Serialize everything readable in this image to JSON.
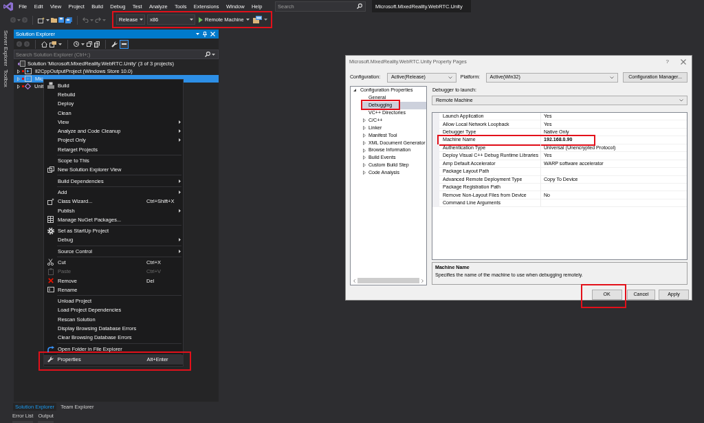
{
  "menu_bar": {
    "items": [
      "File",
      "Edit",
      "View",
      "Project",
      "Build",
      "Debug",
      "Test",
      "Analyze",
      "Tools",
      "Extensions",
      "Window",
      "Help"
    ],
    "search": {
      "placeholder": "Search"
    },
    "solution_title": "Microsoft.MixedReality.WebRTC.Unity"
  },
  "toolbar": {
    "run_group": {
      "outlined": true,
      "configuration": "Release",
      "platform": "x86",
      "start_button": "Remote Machine"
    }
  },
  "side_tabs": [
    "Server Explorer",
    "Toolbox"
  ],
  "solution_explorer": {
    "title": "Solution Explorer",
    "toolbar_toggle": {
      "on": true
    },
    "search": {
      "placeholder": "Search Solution Explorer (Ctrl+;)"
    },
    "tree": [
      {
        "label": "Solution 'Microsoft.MixedReality.WebRTC.Unity' (3 of 3 projects)",
        "selected": false,
        "children": [
          {
            "label": "Il2CppOutputProject (Windows Store 10.0)",
            "kind": "project",
            "expanded": false,
            "selected": false
          },
          {
            "label": "Mic",
            "kind": "project",
            "expanded": false,
            "selected": true
          },
          {
            "label": "Unit",
            "kind": "shared",
            "expanded": false,
            "selected": false
          }
        ]
      }
    ],
    "tabs": [
      {
        "label": "Solution Explorer",
        "selected": true
      },
      {
        "label": "Team Explorer",
        "selected": false
      }
    ]
  },
  "tool_tabs": [
    "Error List",
    "Output"
  ],
  "context_menu": {
    "sections": [
      [
        {
          "label": "Build",
          "submenu": false,
          "disabled": false,
          "hovered": false,
          "outlined": false
        },
        {
          "label": "Rebuild",
          "submenu": false,
          "disabled": false,
          "hovered": false,
          "outlined": false
        },
        {
          "label": "Deploy",
          "submenu": false,
          "disabled": false,
          "hovered": false,
          "outlined": false
        },
        {
          "label": "Clean",
          "submenu": false,
          "disabled": false,
          "hovered": false,
          "outlined": false
        },
        {
          "label": "View",
          "submenu": true,
          "disabled": false,
          "hovered": false,
          "outlined": false
        },
        {
          "label": "Analyze and Code Cleanup",
          "submenu": true,
          "disabled": false,
          "hovered": false,
          "outlined": false
        },
        {
          "label": "Project Only",
          "submenu": true,
          "disabled": false,
          "hovered": false,
          "outlined": false
        },
        {
          "label": "Retarget Projects",
          "submenu": false,
          "disabled": false,
          "hovered": false,
          "outlined": false
        }
      ],
      [
        {
          "label": "Scope to This",
          "submenu": false,
          "disabled": false,
          "hovered": false,
          "outlined": false
        },
        {
          "label": "New Solution Explorer View",
          "submenu": false,
          "disabled": false,
          "hovered": false,
          "outlined": false
        }
      ],
      [
        {
          "label": "Build Dependencies",
          "submenu": true,
          "disabled": false,
          "hovered": false,
          "outlined": false
        }
      ],
      [
        {
          "label": "Add",
          "submenu": true,
          "disabled": false,
          "hovered": false,
          "outlined": false
        },
        {
          "label": "Class Wizard...",
          "shortcut": "Ctrl+Shift+X",
          "submenu": false,
          "disabled": false,
          "hovered": false,
          "outlined": false
        },
        {
          "label": "Publish",
          "submenu": true,
          "disabled": false,
          "hovered": false,
          "outlined": false
        },
        {
          "label": "Manage NuGet Packages...",
          "submenu": false,
          "disabled": false,
          "hovered": false,
          "outlined": false
        }
      ],
      [
        {
          "label": "Set as StartUp Project",
          "submenu": false,
          "disabled": false,
          "hovered": false,
          "outlined": false
        },
        {
          "label": "Debug",
          "submenu": true,
          "disabled": false,
          "hovered": false,
          "outlined": false
        }
      ],
      [
        {
          "label": "Source Control",
          "submenu": true,
          "disabled": false,
          "hovered": false,
          "outlined": false
        }
      ],
      [
        {
          "label": "Cut",
          "shortcut": "Ctrl+X",
          "submenu": false,
          "disabled": false,
          "hovered": false,
          "outlined": false
        },
        {
          "label": "Paste",
          "shortcut": "Ctrl+V",
          "submenu": false,
          "disabled": true,
          "hovered": false,
          "outlined": false
        },
        {
          "label": "Remove",
          "shortcut": "Del",
          "submenu": false,
          "disabled": false,
          "hovered": false,
          "outlined": false
        },
        {
          "label": "Rename",
          "submenu": false,
          "disabled": false,
          "hovered": false,
          "outlined": false
        }
      ],
      [
        {
          "label": "Unload Project",
          "submenu": false,
          "disabled": false,
          "hovered": false,
          "outlined": false
        },
        {
          "label": "Load Project Dependencies",
          "submenu": false,
          "disabled": false,
          "hovered": false,
          "outlined": false
        },
        {
          "label": "Rescan Solution",
          "submenu": false,
          "disabled": false,
          "hovered": false,
          "outlined": false
        },
        {
          "label": "Display Browsing Database Errors",
          "submenu": false,
          "disabled": false,
          "hovered": false,
          "outlined": false
        },
        {
          "label": "Clear Browsing Database Errors",
          "submenu": false,
          "disabled": false,
          "hovered": false,
          "outlined": false
        }
      ],
      [
        {
          "label": "Open Folder in File Explorer",
          "submenu": false,
          "disabled": false,
          "hovered": false,
          "outlined": false
        }
      ],
      [
        {
          "label": "Properties",
          "shortcut": "Alt+Enter",
          "submenu": false,
          "disabled": false,
          "hovered": true,
          "outlined": true
        }
      ]
    ]
  },
  "dialog": {
    "title": "Microsoft.MixedReality.WebRTC.Unity Property Pages",
    "help_button": "?",
    "configuration": {
      "label": "Configuration:",
      "value": "Active(Release)"
    },
    "platform": {
      "label": "Platform:",
      "value": "Active(Win32)"
    },
    "manager_button": "Configuration Manager...",
    "tree": [
      {
        "label": "Configuration Properties",
        "expanded": true,
        "selected": false,
        "children": [
          {
            "label": "General",
            "kind": "leaf",
            "selected": false,
            "outlined": false
          },
          {
            "label": "Debugging",
            "kind": "leaf",
            "selected": true,
            "outlined": true
          },
          {
            "label": "VC++ Directories",
            "kind": "leaf",
            "selected": false,
            "outlined": false
          },
          {
            "label": "C/C++",
            "kind": "group",
            "expanded": false,
            "selected": false,
            "outlined": false
          },
          {
            "label": "Linker",
            "kind": "group",
            "expanded": false,
            "selected": false,
            "outlined": false
          },
          {
            "label": "Manifest Tool",
            "kind": "group",
            "expanded": false,
            "selected": false,
            "outlined": false
          },
          {
            "label": "XML Document Generator",
            "kind": "group",
            "expanded": false,
            "selected": false,
            "outlined": false
          },
          {
            "label": "Browse Information",
            "kind": "group",
            "expanded": false,
            "selected": false,
            "outlined": false
          },
          {
            "label": "Build Events",
            "kind": "group",
            "expanded": false,
            "selected": false,
            "outlined": false
          },
          {
            "label": "Custom Build Step",
            "kind": "group",
            "expanded": false,
            "selected": false,
            "outlined": false
          },
          {
            "label": "Code Analysis",
            "kind": "group",
            "expanded": false,
            "selected": false,
            "outlined": false
          }
        ]
      }
    ],
    "debugger": {
      "label": "Debugger to launch:",
      "value": "Remote Machine"
    },
    "properties": [
      {
        "name": "Launch Application",
        "value": "Yes",
        "modified": false,
        "outlined": false
      },
      {
        "name": "Allow Local Network Loopback",
        "value": "Yes",
        "modified": false,
        "outlined": false
      },
      {
        "name": "Debugger Type",
        "value": "Native Only",
        "modified": false,
        "outlined": false
      },
      {
        "name": "Machine Name",
        "value": "192.168.0.90",
        "modified": true,
        "outlined": true
      },
      {
        "name": "Authentication Type",
        "value": "Universal (Unencrypted Protocol)",
        "modified": false,
        "outlined": false
      },
      {
        "name": "Deploy Visual C++ Debug Runtime Libraries",
        "value": "Yes",
        "modified": false,
        "outlined": false
      },
      {
        "name": "Amp Default Accelerator",
        "value": "WARP software accelerator",
        "modified": false,
        "outlined": false
      },
      {
        "name": "Package Layout Path",
        "outlined": false
      },
      {
        "name": "Advanced Remote Deployment Type",
        "value": "Copy To Device",
        "modified": false,
        "outlined": false
      },
      {
        "name": "Package Registration Path",
        "outlined": false
      },
      {
        "name": "Remove Non-Layout Files from Device",
        "value": "No",
        "modified": false,
        "outlined": false
      },
      {
        "name": "Command Line Arguments",
        "outlined": false
      }
    ],
    "description": {
      "title": "Machine Name",
      "text": "Specifies the name of the machine to use when debugging remotely."
    },
    "buttons": [
      {
        "label": "OK",
        "outlined": true
      },
      {
        "label": "Cancel",
        "outlined": false
      },
      {
        "label": "Apply",
        "outlined": false
      }
    ]
  }
}
